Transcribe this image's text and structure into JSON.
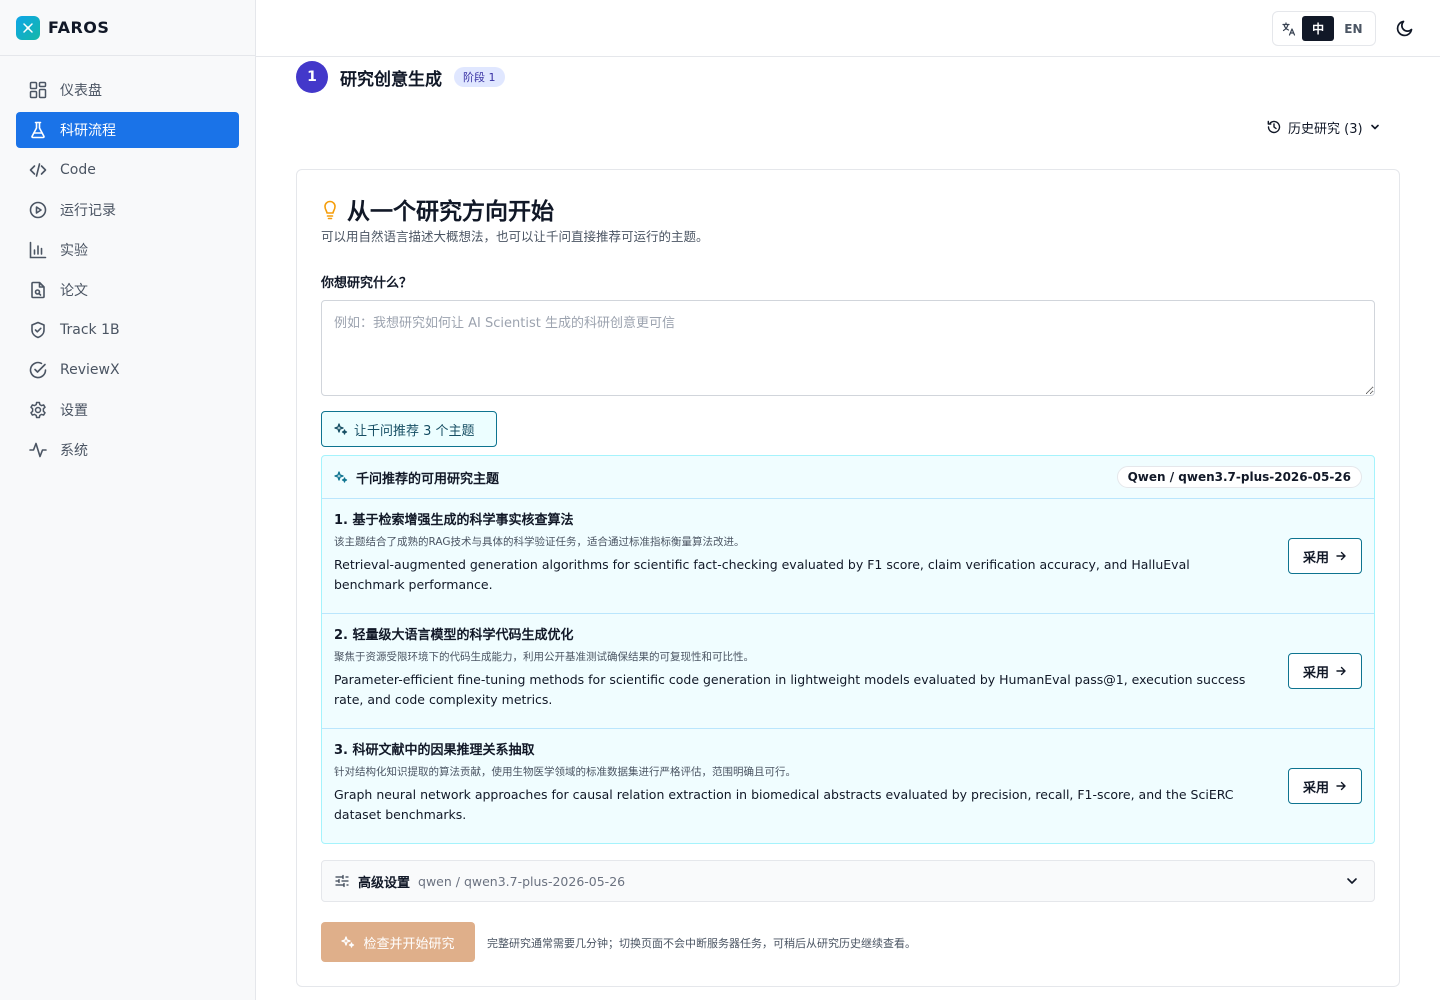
{
  "brand": {
    "name": "FAROS"
  },
  "sidebar": {
    "items": [
      {
        "label": "仪表盘",
        "icon": "dashboard-icon"
      },
      {
        "label": "科研流程",
        "icon": "flask-icon",
        "active": true
      },
      {
        "label": "Code",
        "icon": "code-icon"
      },
      {
        "label": "运行记录",
        "icon": "play-circle-icon"
      },
      {
        "label": "实验",
        "icon": "bar-chart-icon"
      },
      {
        "label": "论文",
        "icon": "file-search-icon"
      },
      {
        "label": "Track 1B",
        "icon": "shield-icon"
      },
      {
        "label": "ReviewX",
        "icon": "check-circle-icon"
      },
      {
        "label": "设置",
        "icon": "gear-icon"
      },
      {
        "label": "系统",
        "icon": "activity-icon"
      }
    ]
  },
  "header": {
    "lang": {
      "zh": "中",
      "en": "EN",
      "active": "zh"
    }
  },
  "stage": {
    "number": "1",
    "title": "研究创意生成",
    "badge": "阶段 1"
  },
  "history": {
    "label": "历史研究 (3)"
  },
  "main": {
    "title": "从一个研究方向开始",
    "subtitle": "可以用自然语言描述大概想法，也可以让千问直接推荐可运行的主题。",
    "question_label": "你想研究什么？",
    "input": {
      "value": "",
      "placeholder": "例如：我想研究如何让 AI Scientist 生成的科研创意更可信"
    },
    "suggest_button": "让千问推荐 3 个主题"
  },
  "suggestions": {
    "title": "千问推荐的可用研究主题",
    "model": "Qwen / qwen3.7-plus-2026-05-26",
    "topics": [
      {
        "title": "1. 基于检索增强生成的科学事实核查算法",
        "note": "该主题结合了成熟的RAG技术与具体的科学验证任务，适合通过标准指标衡量算法改进。",
        "desc": "Retrieval-augmented generation algorithms for scientific fact-checking evaluated by F1 score, claim verification accuracy, and HalluEval benchmark performance.",
        "button": "采用"
      },
      {
        "title": "2. 轻量级大语言模型的科学代码生成优化",
        "note": "聚焦于资源受限环境下的代码生成能力，利用公开基准测试确保结果的可复现性和可比性。",
        "desc": "Parameter-efficient fine-tuning methods for scientific code generation in lightweight models evaluated by HumanEval pass@1, execution success rate, and code complexity metrics.",
        "button": "采用"
      },
      {
        "title": "3. 科研文献中的因果推理关系抽取",
        "note": "针对结构化知识提取的算法贡献，使用生物医学领域的标准数据集进行严格评估，范围明确且可行。",
        "desc": "Graph neural network approaches for causal relation extraction in biomedical abstracts evaluated by precision, recall, F1-score, and the SciERC dataset benchmarks.",
        "button": "采用"
      }
    ]
  },
  "advanced": {
    "label": "高级设置",
    "model": "qwen / qwen3.7-plus-2026-05-26"
  },
  "start": {
    "button": "检查并开始研究",
    "note": "完整研究通常需要几分钟；切换页面不会中断服务器任务，可稍后从研究历史继续查看。"
  },
  "colors": {
    "sidebar_active": "#1a73e8",
    "stage_circle": "#4338ca",
    "accent_teal": "#0e7490",
    "start_button": "#dfaf8a",
    "idea_bulb": "#f59e0b"
  }
}
